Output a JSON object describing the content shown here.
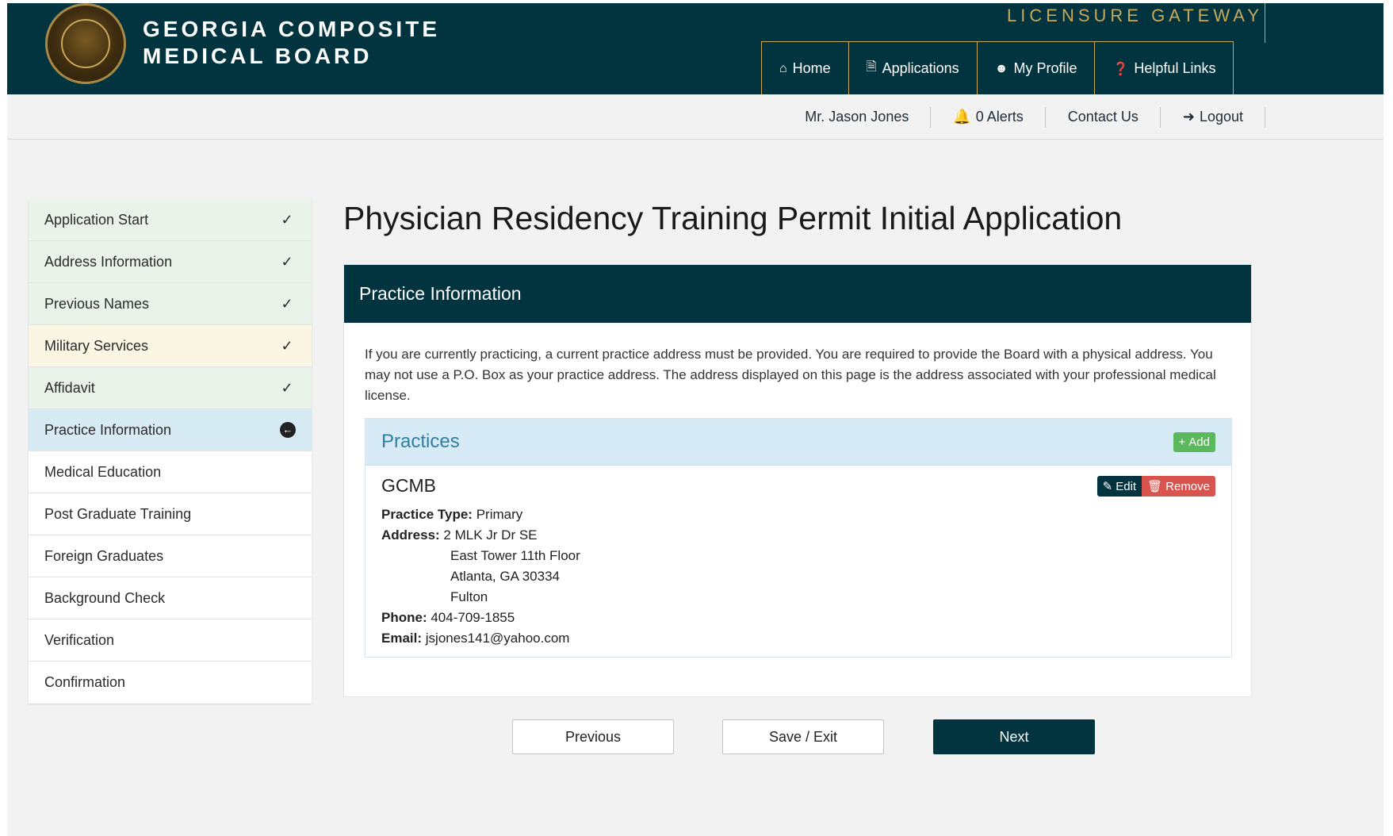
{
  "header": {
    "brand_line1": "GEORGIA COMPOSITE",
    "brand_line2": "MEDICAL BOARD",
    "gateway": "LICENSURE GATEWAY",
    "nav": [
      {
        "label": "Home",
        "icon": "home-icon"
      },
      {
        "label": "Applications",
        "icon": "document-icon"
      },
      {
        "label": "My Profile",
        "icon": "user-icon"
      },
      {
        "label": "Helpful Links",
        "icon": "question-icon"
      }
    ]
  },
  "subnav": {
    "user": "Mr. Jason Jones",
    "alerts": "0 Alerts",
    "contact": "Contact Us",
    "logout": "Logout"
  },
  "sidebar": {
    "steps": [
      {
        "label": "Application Start",
        "state": "done"
      },
      {
        "label": "Address Information",
        "state": "done"
      },
      {
        "label": "Previous Names",
        "state": "done"
      },
      {
        "label": "Military Services",
        "state": "warn"
      },
      {
        "label": "Affidavit",
        "state": "done"
      },
      {
        "label": "Practice Information",
        "state": "active"
      },
      {
        "label": "Medical Education",
        "state": "todo"
      },
      {
        "label": "Post Graduate Training",
        "state": "todo"
      },
      {
        "label": "Foreign Graduates",
        "state": "todo"
      },
      {
        "label": "Background Check",
        "state": "todo"
      },
      {
        "label": "Verification",
        "state": "todo"
      },
      {
        "label": "Confirmation",
        "state": "todo"
      }
    ]
  },
  "main": {
    "title": "Physician Residency Training Permit Initial Application",
    "panel_title": "Practice Information",
    "intro": "If you are currently practicing, a current practice address must be provided. You are required to provide the Board with a physical address. You may not use a P.O. Box as your practice address. The address displayed on this page is the address associated with your professional medical license.",
    "practices_title": "Practices",
    "add_label": "Add",
    "practice": {
      "name": "GCMB",
      "edit_label": "Edit",
      "remove_label": "Remove",
      "type_label": "Practice Type:",
      "type_value": "Primary",
      "address_label": "Address:",
      "address_line1": "2 MLK Jr Dr SE",
      "address_line2": "East Tower 11th Floor",
      "address_line3": "Atlanta, GA 30334",
      "address_line4": "Fulton",
      "phone_label": "Phone:",
      "phone_value": "404-709-1855",
      "email_label": "Email:",
      "email_value": "jsjones141@yahoo.com"
    }
  },
  "buttons": {
    "previous": "Previous",
    "save_exit": "Save / Exit",
    "next": "Next"
  },
  "colors": {
    "navy": "#023440",
    "gold": "#c9a85a",
    "success": "#5cb85c",
    "danger": "#d9534f"
  }
}
